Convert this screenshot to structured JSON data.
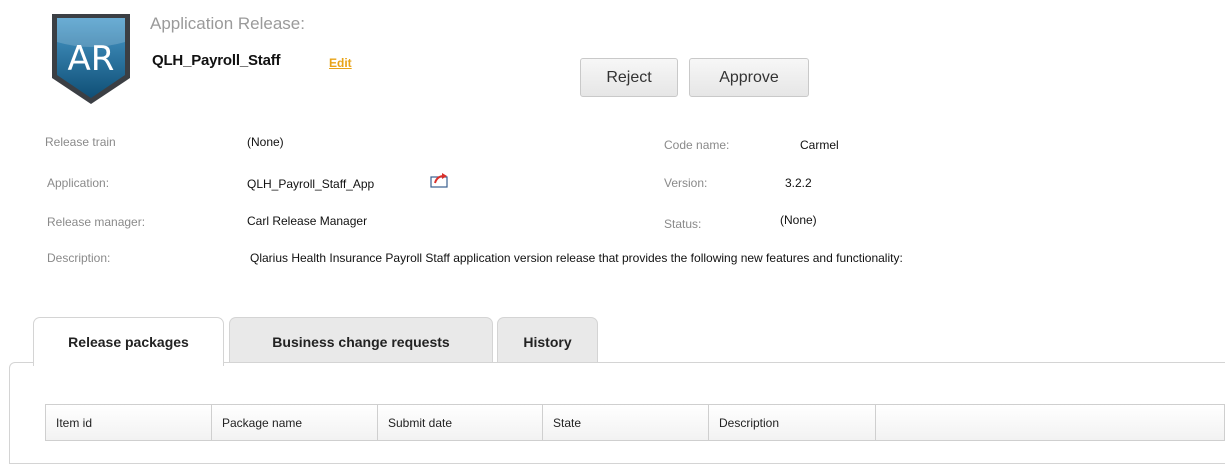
{
  "header": {
    "logo_text": "AR",
    "kind_label": "Application Release:",
    "name": "QLH_Payroll_Staff",
    "edit_label": "Edit"
  },
  "actions": {
    "reject_label": "Reject",
    "approve_label": "Approve"
  },
  "details": {
    "release_train": {
      "label": "Release train",
      "value": "(None)"
    },
    "application": {
      "label": "Application:",
      "value": "QLH_Payroll_Staff_App",
      "icon": "share-icon"
    },
    "release_manager": {
      "label": "Release manager:",
      "value": "Carl Release Manager"
    },
    "description": {
      "label": "Description:",
      "value": "Qlarius Health Insurance Payroll Staff application version release that provides the following new features and functionality:"
    },
    "code_name": {
      "label": "Code name:",
      "value": "Carmel"
    },
    "version": {
      "label": "Version:",
      "value": "3.2.2"
    },
    "status": {
      "label": "Status:",
      "value": "(None)"
    }
  },
  "tabs": [
    {
      "label": "Release packages",
      "active": true
    },
    {
      "label": "Business change requests",
      "active": false
    },
    {
      "label": "History",
      "active": false
    }
  ],
  "table": {
    "columns": [
      "Item id",
      "Package name",
      "Submit date",
      "State",
      "Description",
      ""
    ]
  },
  "colors": {
    "edit_link": "#e8a317",
    "logo_blue": "#1f6c99",
    "icon_red": "#d9302c"
  }
}
